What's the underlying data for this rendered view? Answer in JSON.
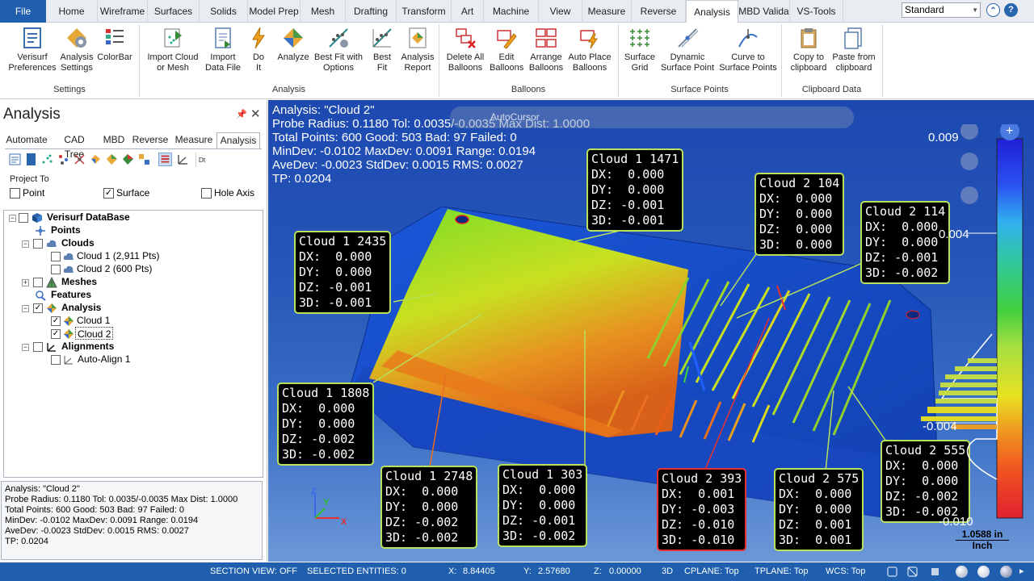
{
  "file_tab": "File",
  "tabs": [
    "Home",
    "Wireframe",
    "Surfaces",
    "Solids",
    "Model Prep",
    "Mesh",
    "Drafting",
    "Transform",
    "Art",
    "Machine",
    "View",
    "Measure",
    "Reverse",
    "Analysis",
    "MBD Valida",
    "VS-Tools"
  ],
  "active_tab": "Analysis",
  "workspace_select": "Standard",
  "ribbon": {
    "settings": {
      "label": "Settings",
      "buttons": [
        "Verisurf\nPreferences",
        "Analysis\nSettings",
        "ColorBar"
      ]
    },
    "analysis": {
      "label": "Analysis",
      "buttons": [
        "Import Cloud\nor Mesh",
        "Import\nData File",
        "Do\nIt",
        "Analyze",
        "Best Fit with\nOptions",
        "Best\nFit",
        "Analysis\nReport"
      ]
    },
    "balloons": {
      "label": "Balloons",
      "buttons": [
        "Delete All\nBalloons",
        "Edit\nBalloons",
        "Arrange\nBalloons",
        "Auto Place\nBalloons"
      ]
    },
    "surface_points": {
      "label": "Surface Points",
      "buttons": [
        "Surface\nGrid",
        "Dynamic\nSurface Point",
        "Curve to\nSurface Points"
      ]
    },
    "clipboard": {
      "label": "Clipboard Data",
      "buttons": [
        "Copy to\nclipboard",
        "Paste from\nclipboard"
      ]
    }
  },
  "panel": {
    "title": "Analysis",
    "tabs": [
      "Automate",
      "CAD Tree",
      "MBD",
      "Reverse",
      "Measure",
      "Analysis"
    ],
    "active_tab": "Analysis",
    "project_to": {
      "label": "Project To",
      "point": "Point",
      "surface": "Surface",
      "hole_axis": "Hole Axis",
      "surface_checked": true
    },
    "tree": {
      "root": "Verisurf DataBase",
      "points": "Points",
      "clouds": "Clouds",
      "cloud1": "Cloud 1 (2,911 Pts)",
      "cloud2": "Cloud 2 (600 Pts)",
      "meshes": "Meshes",
      "features": "Features",
      "analysis": "Analysis",
      "an_cloud1": "Cloud 1",
      "an_cloud2": "Cloud 2",
      "alignments": "Alignments",
      "auto_align": "Auto-Align 1"
    },
    "info": [
      "Analysis: \"Cloud 2\"",
      "Probe Radius: 0.1180 Tol: 0.0035/-0.0035 Max Dist: 1.0000",
      "Total Points: 600 Good: 503 Bad: 97 Failed: 0",
      "MinDev: -0.0102 MaxDev: 0.0091 Range: 0.0194",
      "AveDev: -0.0023 StdDev: 0.0015 RMS: 0.0027",
      "TP: 0.0204"
    ]
  },
  "viewport": {
    "overlay": [
      "Analysis: \"Cloud 2\"",
      "Probe Radius: 0.1180 Tol: 0.0035/-0.0035 Max Dist: 1.0000",
      "Total Points: 600 Good: 503 Bad: 97 Failed: 0",
      "MinDev: -0.0102 MaxDev: 0.0091 Range: 0.0194",
      "AveDev: -0.0023 StdDev: 0.0015 RMS: 0.0027",
      "TP: 0.0204"
    ],
    "autocursor": "AutoCursor",
    "balloons": [
      {
        "title": "Cloud 1 2435",
        "dx": "0.000",
        "dy": "0.000",
        "dz": "-0.001",
        "d3": "-0.001",
        "red": false
      },
      {
        "title": "Cloud 1 1471",
        "dx": "0.000",
        "dy": "0.000",
        "dz": "-0.001",
        "d3": "-0.001",
        "red": false
      },
      {
        "title": "Cloud 2 104",
        "dx": "0.000",
        "dy": "0.000",
        "dz": "0.000",
        "d3": "0.000",
        "red": false
      },
      {
        "title": "Cloud 2 114",
        "dx": "0.000",
        "dy": "0.000",
        "dz": "-0.001",
        "d3": "-0.002",
        "red": false
      },
      {
        "title": "Cloud 1 1808",
        "dx": "0.000",
        "dy": "0.000",
        "dz": "-0.002",
        "d3": "-0.002",
        "red": false
      },
      {
        "title": "Cloud 1 2748",
        "dx": "0.000",
        "dy": "0.000",
        "dz": "-0.002",
        "d3": "-0.002",
        "red": false
      },
      {
        "title": "Cloud 1 303",
        "dx": "0.000",
        "dy": "0.000",
        "dz": "-0.001",
        "d3": "-0.002",
        "red": false
      },
      {
        "title": "Cloud 2 393",
        "dx": "0.001",
        "dy": "-0.003",
        "dz": "-0.010",
        "d3": "-0.010",
        "red": true
      },
      {
        "title": "Cloud 2 575",
        "dx": "0.000",
        "dy": "0.000",
        "dz": "0.001",
        "d3": "0.001",
        "red": false
      },
      {
        "title": "Cloud 2 555",
        "dx": "0.000",
        "dy": "0.000",
        "dz": "-0.002",
        "d3": "-0.002",
        "red": false
      }
    ],
    "scale_labels": [
      "0.009",
      "0.004",
      "-0.004",
      "-0.010"
    ],
    "measure_value": "1.0588 in",
    "measure_unit": "Inch"
  },
  "status": {
    "section_view": "SECTION VIEW: OFF",
    "selected": "SELECTED ENTITIES: 0",
    "x_label": "X:",
    "x": "8.84405",
    "y_label": "Y:",
    "y": "2.57680",
    "z_label": "Z:",
    "z": "0.00000",
    "mode": "3D",
    "cplane": "CPLANE: Top",
    "tplane": "TPLANE: Top",
    "wcs": "WCS: Top"
  },
  "colors": {
    "accent": "#1f5fae",
    "balloon_border": "#b8e05a",
    "balloon_fail": "#e83030"
  }
}
